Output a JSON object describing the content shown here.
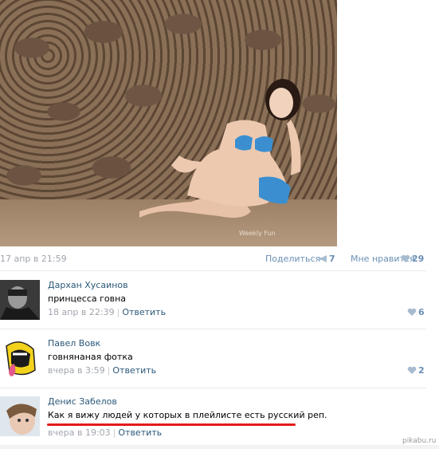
{
  "post": {
    "date": "17 апр в 21:59",
    "share_label": "Поделиться",
    "share_count": "7",
    "dislike_label": "Мне нравится",
    "like_count": "29",
    "photo_watermark": "Weekly Fun"
  },
  "comments": [
    {
      "author": "Дархан Хусаинов",
      "text": "принцесса говна",
      "date": "18 апр в 22:39",
      "reply_label": "Ответить",
      "likes": "6"
    },
    {
      "author": "Павел Вовк",
      "text": "говнянаная фотка",
      "date": "вчера в 3:59",
      "reply_label": "Ответить",
      "likes": "2"
    },
    {
      "author": "Денис Забелов",
      "text": "Как я вижу людей у которых в плейлисте есть русский реп.",
      "date": "вчера в 19:03",
      "reply_label": "Ответить"
    }
  ],
  "site_watermark": "pikabu.ru",
  "colors": {
    "link": "#2b587a",
    "muted": "#a0a5ad",
    "action": "#6b8fb4",
    "underline": "#e31b1b"
  },
  "icons": {
    "share": "megaphone-icon",
    "like": "heart-icon"
  }
}
